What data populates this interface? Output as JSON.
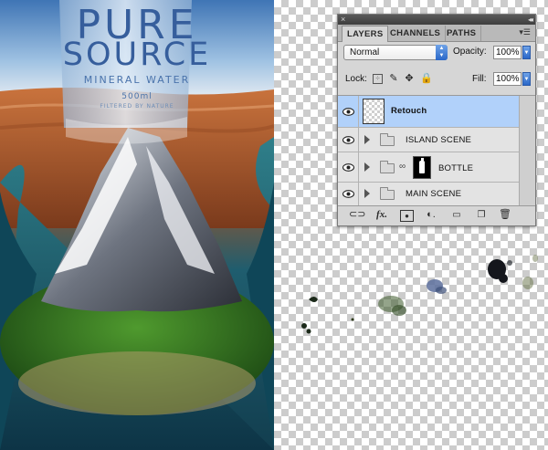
{
  "artwork": {
    "bottle_brand_line1": "PURE",
    "bottle_brand_line2": "SOURCE",
    "bottle_subtitle": "MINERAL WATER",
    "bottle_volume": "500ml",
    "bottle_tagline": "FILTERED BY NATURE"
  },
  "layers_panel": {
    "tabs": [
      {
        "label": "LAYERS",
        "active": true
      },
      {
        "label": "CHANNELS",
        "active": false
      },
      {
        "label": "PATHS",
        "active": false
      }
    ],
    "blend_mode": "Normal",
    "opacity_label": "Opacity:",
    "opacity_value": "100%",
    "lock_label": "Lock:",
    "fill_label": "Fill:",
    "fill_value": "100%",
    "layers": [
      {
        "name": "Retouch",
        "type": "layer",
        "selected": true,
        "visible": true
      },
      {
        "name": "ISLAND SCENE",
        "type": "group",
        "selected": false,
        "visible": true
      },
      {
        "name": "BOTTLE",
        "type": "group-with-mask",
        "selected": false,
        "visible": true
      },
      {
        "name": "MAIN SCENE",
        "type": "group",
        "selected": false,
        "visible": true
      }
    ],
    "bottom_icons": [
      "link-layers-icon",
      "fx-icon",
      "add-mask-icon",
      "adjustment-layer-icon",
      "new-group-icon",
      "new-layer-icon",
      "trash-icon"
    ],
    "colors": {
      "selected_row": "#b1d1fa",
      "accent_blue": "#2a67c8"
    }
  }
}
